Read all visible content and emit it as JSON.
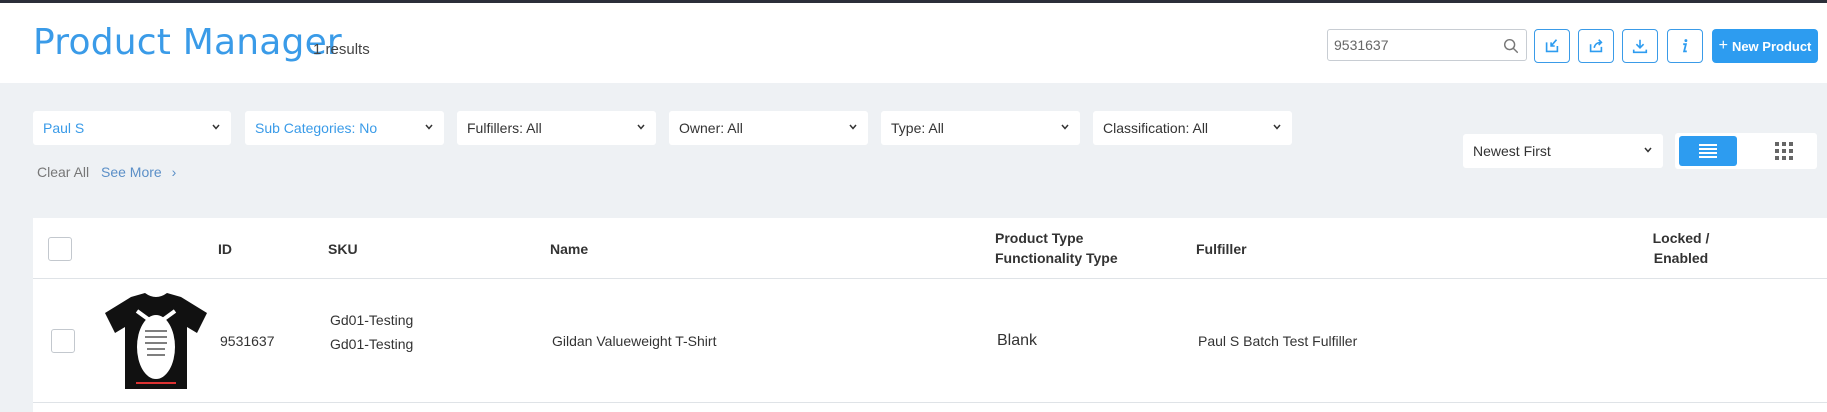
{
  "header": {
    "title": "Product Manager",
    "results": "1 results",
    "search": {
      "value": "9531637",
      "placeholder": ""
    },
    "new_product_label": "New Product",
    "toolbar_icons": [
      "import-icon",
      "share-icon",
      "download-icon",
      "info-icon"
    ]
  },
  "filters": {
    "account": "Paul S",
    "sub_categories": "Sub Categories: No",
    "fulfillers": "Fulfillers: All",
    "owner": "Owner: All",
    "type": "Type: All",
    "classification": "Classification: All",
    "clear_all": "Clear All",
    "see_more": "See More",
    "see_more_chevron": "›"
  },
  "sort": {
    "value": "Newest First"
  },
  "table": {
    "headers": {
      "id": "ID",
      "sku": "SKU",
      "name": "Name",
      "product_type": "Product Type",
      "functionality_type": "Functionality Type",
      "fulfiller": "Fulfiller",
      "locked": "Locked /",
      "enabled": "Enabled"
    },
    "rows": [
      {
        "id": "9531637",
        "sku1": "Gd01-Testing",
        "sku2": "Gd01-Testing",
        "name": "Gildan Valueweight T-Shirt",
        "type": "Blank",
        "fulfiller": "Paul S Batch Test Fulfiller"
      }
    ]
  },
  "colors": {
    "accent": "#2d9cf0",
    "title": "#3a9be8",
    "background": "#eef1f4"
  }
}
